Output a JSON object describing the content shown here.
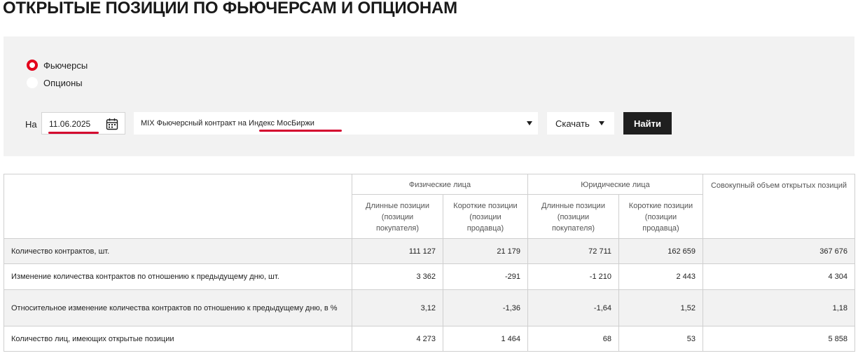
{
  "page": {
    "title": "ОТКРЫТЫЕ ПОЗИЦИИ ПО ФЬЮЧЕРСАМ И ОПЦИОНАМ"
  },
  "filters": {
    "instrument_options": [
      {
        "label": "Фьючерсы",
        "selected": true
      },
      {
        "label": "Опционы",
        "selected": false
      }
    ],
    "date_label": "На",
    "date_value": "11.06.2025",
    "contract_value_prefix": "MIX Фьючерсный контракт на ",
    "contract_value_highlight": "Индекс МосБиржи",
    "contract_value": "MIX Фьючерсный контракт на Индекс МосБиржи",
    "download_label": "Скачать",
    "find_label": "Найти",
    "accent_color": "#e3001b",
    "underline_color": "#d4002e"
  },
  "table": {
    "group_headers": [
      "Физические лица",
      "Юридические лица",
      "Совокупный объем открытых позиций"
    ],
    "sub_headers": [
      "Длинные позиции (позиции покупателя)",
      "Короткие позиции (позиции продавца)",
      "Длинные позиции (позиции покупателя)",
      "Короткие позиции (позиции продавца)"
    ],
    "rows": [
      {
        "label": "Количество контрактов, шт.",
        "values": [
          "111 127",
          "21 179",
          "72 711",
          "162 659",
          "367 676"
        ]
      },
      {
        "label": "Изменение количества контрактов по отношению к предыдущему дню, шт.",
        "values": [
          "3 362",
          "-291",
          "-1 210",
          "2 443",
          "4 304"
        ]
      },
      {
        "label": "Относительное изменение количества контрактов по отношению к предыдущему дню, в %",
        "values": [
          "3,12",
          "-1,36",
          "-1,64",
          "1,52",
          "1,18"
        ]
      },
      {
        "label": "Количество лиц, имеющих открытые позиции",
        "values": [
          "4 273",
          "1 464",
          "68",
          "53",
          "5 858"
        ]
      }
    ]
  }
}
